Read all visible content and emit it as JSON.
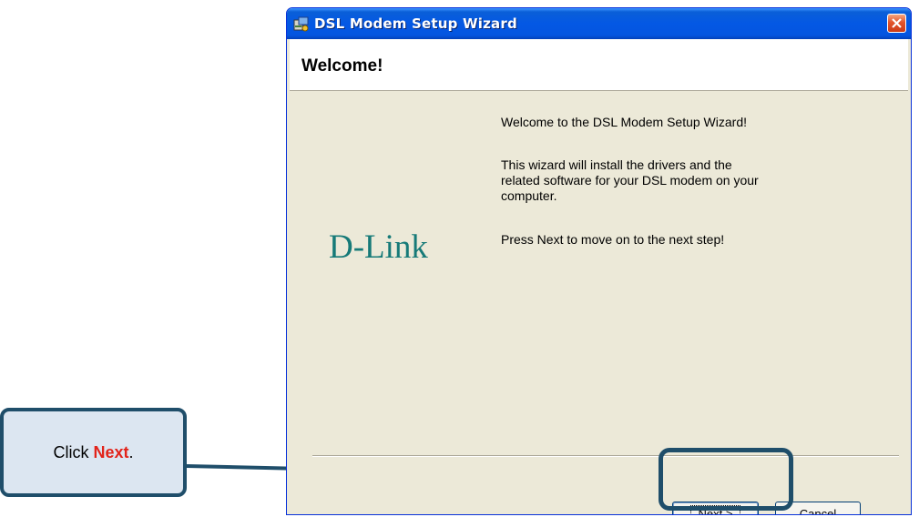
{
  "window": {
    "title": "DSL Modem Setup Wizard",
    "header_title": "Welcome!"
  },
  "content": {
    "logo_text": "D-Link",
    "line1": "Welcome to the DSL Modem Setup Wizard!",
    "line2": "This wizard will install the drivers and the related software for your DSL modem on your computer.",
    "line3": "Press Next to move on to the next step!"
  },
  "buttons": {
    "next_label": "Next >",
    "cancel_label": "Cancel"
  },
  "callout": {
    "prefix": "Click ",
    "emphasis": "Next",
    "suffix": "."
  },
  "icons": {
    "app": "modem-setup-icon",
    "close": "close-icon"
  },
  "colors": {
    "titlebar": "#0458e4",
    "logo": "#167a78",
    "callout_emphasis": "#e2231a",
    "callout_border": "#1f4e6a"
  }
}
